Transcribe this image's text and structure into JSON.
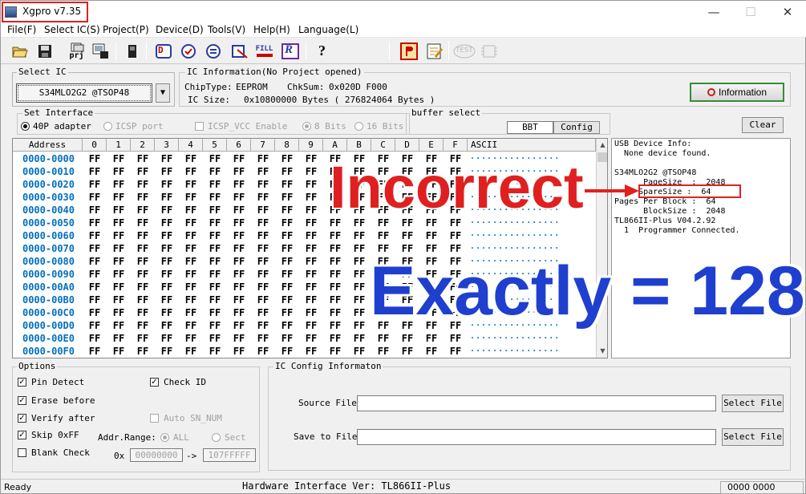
{
  "window": {
    "title": "Xgpro v7.35",
    "minimize": "—",
    "maximize": "☐",
    "close": "✕"
  },
  "menu": [
    "File(F)",
    "Select IC(S)",
    "Project(P)",
    "Device(D)",
    "Tools(V)",
    "Help(H)",
    "Language(L)"
  ],
  "toolbar": {
    "prj_label": "prj",
    "fill_label": "FILL",
    "r_label": "R",
    "d_label": "D",
    "test_label": "TEST",
    "help_label": "?"
  },
  "select_ic": {
    "group_title": "Select IC",
    "value": "S34MLO2G2 @TSOP48",
    "arrow": "▼"
  },
  "ic_info": {
    "group_title": "IC Information(No Project opened)",
    "chiptype_label": "ChipType:",
    "chiptype": "EEPROM",
    "chksum_label": "ChkSum:",
    "chksum": "0x020D F000",
    "icsize_label": "IC Size:",
    "icsize": "0x10800000 Bytes ( 276824064 Bytes )",
    "information_button": "Information"
  },
  "set_interface": {
    "group_title": "Set Interface",
    "adapter": "40P adapter",
    "icsp_port": "ICSP port",
    "icsp_vcc": "ICSP_VCC Enable",
    "bits8": "8 Bits",
    "bits16": "16 Bits"
  },
  "buffer_select": {
    "group_title": "buffer select",
    "value": "BBT",
    "config_button": "Config"
  },
  "clear_button": "Clear",
  "hex": {
    "header_address": "Address",
    "header_cols": [
      "0",
      "1",
      "2",
      "3",
      "4",
      "5",
      "6",
      "7",
      "8",
      "9",
      "A",
      "B",
      "C",
      "D",
      "E",
      "F"
    ],
    "header_ascii": "ASCII",
    "rows": [
      "0000-0000",
      "0000-0010",
      "0000-0020",
      "0000-0030",
      "0000-0040",
      "0000-0050",
      "0000-0060",
      "0000-0070",
      "0000-0080",
      "0000-0090",
      "0000-00A0",
      "0000-00B0",
      "0000-00C0",
      "0000-00D0",
      "0000-00E0",
      "0000-00F0"
    ],
    "byte": "FF",
    "ascii_dots": "................",
    "scroll_up": "▲",
    "scroll_down": "▼"
  },
  "usb_info": {
    "lines": [
      "USB Device Info:",
      "  None device found.",
      "",
      "S34MLO2G2 @TSOP48",
      "      PageSize  :  2048",
      "     SpareSize :  64",
      "Pages Per Block :  64",
      "      BlockSize :  2048",
      "TL866II-Plus V04.2.92",
      "  1  Programmer Connected."
    ]
  },
  "overlay": {
    "incorrect": "Incorrect",
    "arrow": "→",
    "exactly": "Exactly = 128"
  },
  "options": {
    "group_title": "Options",
    "pin_detect": "Pin Detect",
    "check_id": "Check ID",
    "erase_before": "Erase before",
    "verify_after": "Verify after",
    "auto_sn": "Auto SN_NUM",
    "skip_0xff": "Skip 0xFF",
    "blank_check": "Blank Check",
    "addr_range": "Addr.Range:",
    "all": "ALL",
    "sect": "Sect",
    "ox": "0x",
    "addr_from": "00000000",
    "arrow": "->",
    "addr_to": "107FFFFF"
  },
  "ic_config": {
    "group_title": "IC Config Informaton",
    "source_label": "Source File",
    "save_label": "Save to File",
    "select_file": "Select File"
  },
  "status": {
    "left": "Ready",
    "center": "Hardware Interface Ver: TL866II-Plus",
    "right": "0000 0000"
  },
  "colors": {
    "address_blue": "#0070c0",
    "overlay_red": "#e02020",
    "overlay_blue": "#1f3fcf"
  }
}
